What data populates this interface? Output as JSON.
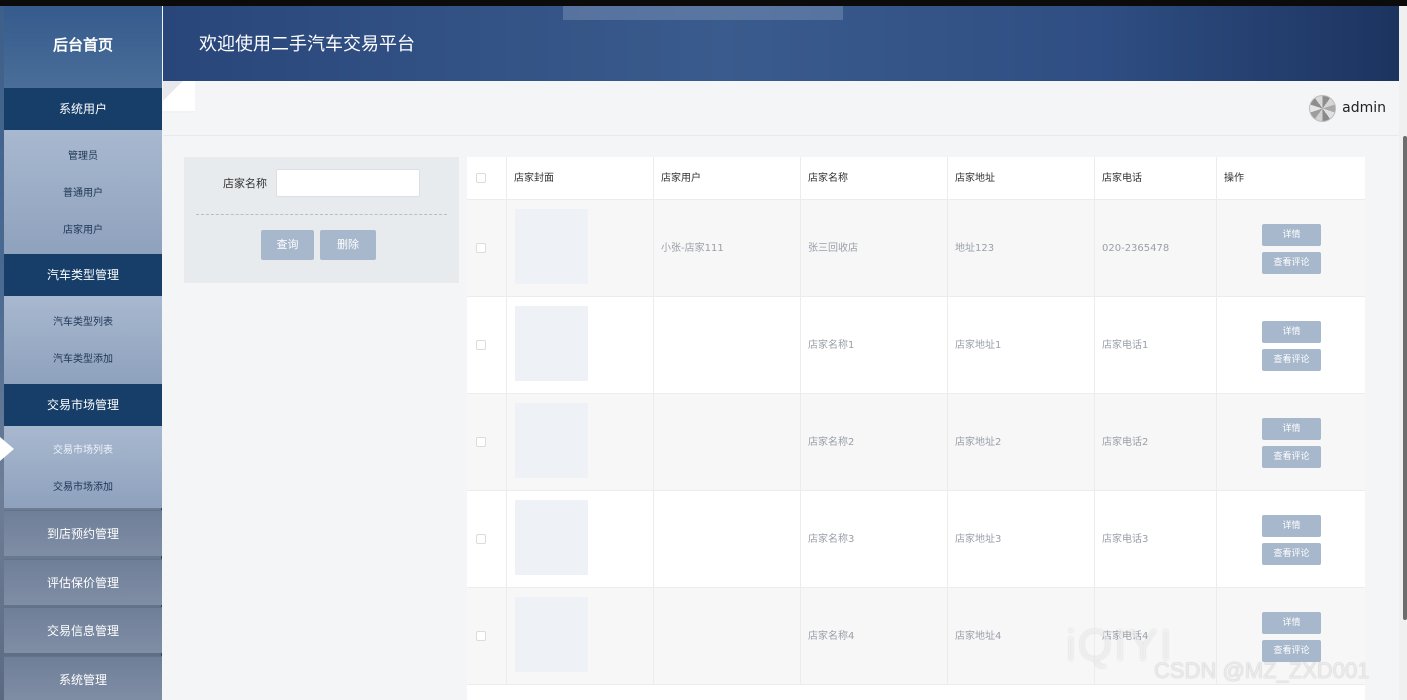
{
  "header": {
    "title": "欢迎使用二手汽车交易平台"
  },
  "user": {
    "name": "admin"
  },
  "sidebar": {
    "home": "后台首页",
    "groups": [
      {
        "title": "系统用户",
        "items": [
          "管理员",
          "普通用户",
          "店家用户"
        ]
      },
      {
        "title": "汽车类型管理",
        "items": [
          "汽车类型列表",
          "汽车类型添加"
        ]
      },
      {
        "title": "交易市场管理",
        "items": [
          "交易市场列表",
          "交易市场添加"
        ]
      }
    ],
    "flat": [
      "到店预约管理",
      "评估保价管理",
      "交易信息管理",
      "系统管理"
    ]
  },
  "search": {
    "label": "店家名称",
    "value": "",
    "query_button": "查询",
    "delete_button": "删除"
  },
  "table": {
    "headers": [
      "店家封面",
      "店家用户",
      "店家名称",
      "店家地址",
      "店家电话",
      "操作"
    ],
    "rows": [
      {
        "user": "小张-店家111",
        "name": "张三回收店",
        "address": "地址123",
        "phone": "020-2365478"
      },
      {
        "user": "",
        "name": "店家名称1",
        "address": "店家地址1",
        "phone": "店家电话1"
      },
      {
        "user": "",
        "name": "店家名称2",
        "address": "店家地址2",
        "phone": "店家电话2"
      },
      {
        "user": "",
        "name": "店家名称3",
        "address": "店家地址3",
        "phone": "店家电话3"
      },
      {
        "user": "",
        "name": "店家名称4",
        "address": "店家地址4",
        "phone": "店家电话4"
      }
    ],
    "detail_button": "详情",
    "review_button": "查看评论"
  },
  "watermark": {
    "logo": "iQIYI",
    "credit": "CSDN @MZ_ZXD001"
  }
}
